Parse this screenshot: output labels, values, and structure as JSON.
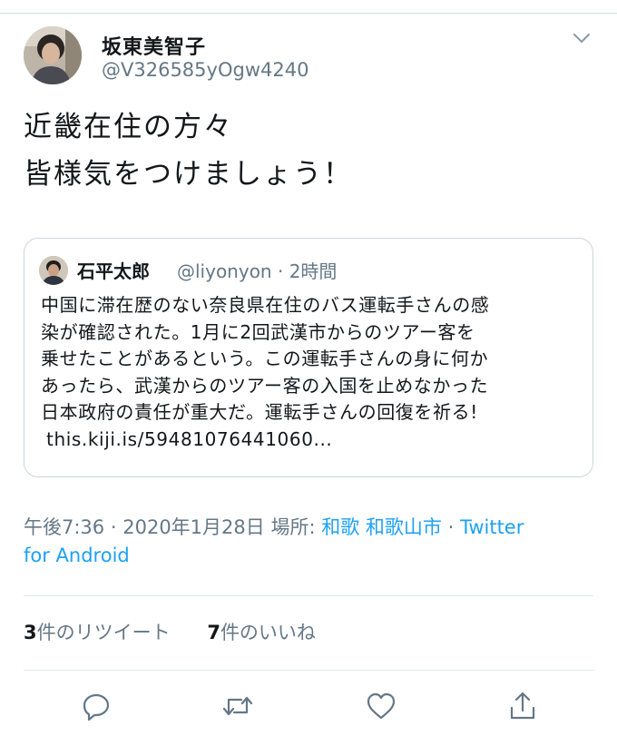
{
  "tweet": {
    "author_name": "坂東美智子",
    "author_handle": "@V326585yOgw4240",
    "text_lines": [
      "近畿在住の方々",
      "皆様気をつけましょう！"
    ]
  },
  "quoted_tweet": {
    "author_name": "石平太郎",
    "author_handle": "@liyonyon",
    "separator": "·",
    "time_ago": "2時間",
    "body_lines": [
      "中国に滞在歴のない奈良県在住のバス運転手さんの感",
      "染が確認された。1月に2回武漢市からのツアー客を",
      "乗せたことがあるという。この運転手さんの身に何か",
      "あったら、武漢からのツアー客の入国を止めなかった",
      "日本政府の責任が重大だ。運転手さんの回復を祈る!"
    ],
    "link_text": "this.kiji.is/59481076441060..."
  },
  "meta": {
    "time": "午後7:36",
    "sep1": "·",
    "date": "2020年1月28日",
    "location_label": "場所:",
    "location": "和歌 和歌山市",
    "sep2": "·",
    "source_part1": "Twitter",
    "source_part2": "for Android"
  },
  "stats": {
    "retweets_count": "3",
    "retweets_label": "件のリツイート",
    "likes_count": "7",
    "likes_label": "件のいいね"
  },
  "icons": {
    "chevron": "chevron-down-icon",
    "reply": "reply-icon",
    "retweet": "retweet-icon",
    "like": "like-icon",
    "share": "share-icon"
  },
  "colors": {
    "link": "#1da1f2",
    "secondary_text": "#657786",
    "primary_text": "#14171a",
    "divider": "#e1e8ed"
  }
}
